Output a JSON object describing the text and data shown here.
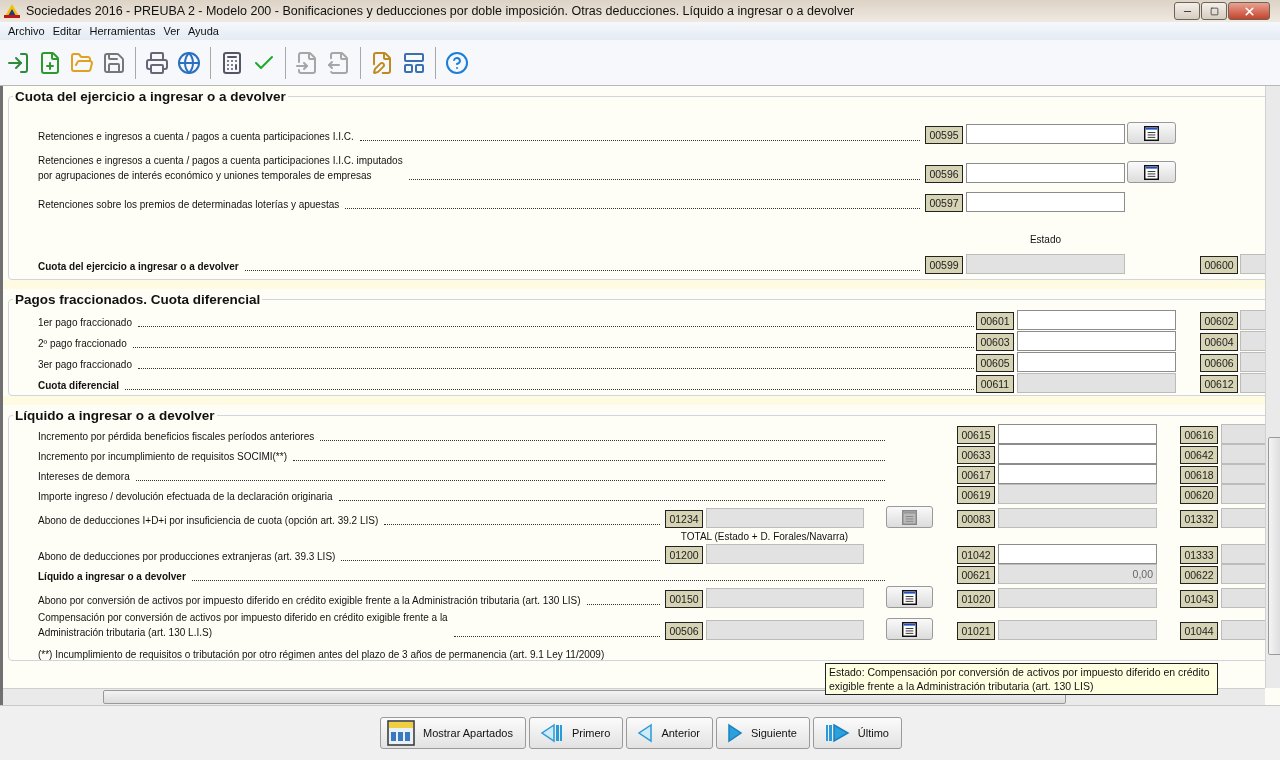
{
  "window": {
    "title": "Sociedades 2016 - PREUBA 2 - Modelo 200 - Bonificaciones y deducciones por doble imposición. Otras deducciones. Líquido a ingresar o a devolver"
  },
  "menu": [
    "Archivo",
    "Editar",
    "Herramientas",
    "Ver",
    "Ayuda"
  ],
  "toolbar": [
    {
      "kind": "button",
      "disabled": false
    },
    {
      "kind": "button",
      "disabled": false
    },
    {
      "kind": "button",
      "disabled": false
    },
    {
      "kind": "button",
      "disabled": false
    },
    {
      "kind": "separator"
    },
    {
      "kind": "button",
      "disabled": false
    },
    {
      "kind": "button",
      "disabled": false
    },
    {
      "kind": "separator"
    },
    {
      "kind": "button",
      "disabled": false
    },
    {
      "kind": "button",
      "disabled": false
    },
    {
      "kind": "separator"
    },
    {
      "kind": "button",
      "disabled": true
    },
    {
      "kind": "button",
      "disabled": true
    },
    {
      "kind": "separator"
    },
    {
      "kind": "button",
      "disabled": false
    },
    {
      "kind": "button",
      "disabled": false
    },
    {
      "kind": "separator"
    },
    {
      "kind": "button",
      "disabled": false
    }
  ],
  "sections": [
    {
      "title": "Cuota del ejercicio a ingresar o a devolver",
      "kind": "wide",
      "rows": [
        {
          "kind": "field",
          "label": "Retenciones e ingresos a cuenta / pagos a cuenta participaciones I.I.C.",
          "bold": false,
          "code": "00595",
          "disabled": false,
          "button": {
            "disabled": false
          }
        },
        {
          "kind": "field",
          "label": "Retenciones e ingresos a cuenta / pagos a cuenta participaciones I.I.C. imputados\npor agrupaciones de interés económico y uniones temporales de empresas",
          "bold": false,
          "code": "00596",
          "disabled": false,
          "button": {
            "disabled": false
          }
        },
        {
          "kind": "field",
          "label": "Retenciones sobre los premios de determinadas loterías y apuestas",
          "bold": false,
          "code": "00597",
          "disabled": false
        },
        {
          "kind": "caption",
          "text": "Estado"
        },
        {
          "kind": "field",
          "label": "Cuota del ejercicio a ingresar o a devolver",
          "bold": true,
          "code": "00599",
          "disabled": true,
          "right_code": "00600"
        }
      ]
    },
    {
      "title": "Pagos fraccionados. Cuota diferencial",
      "kind": "compact",
      "rows": [
        {
          "kind": "field",
          "label": "1er pago fraccionado",
          "bold": false,
          "code": "00601",
          "disabled": false,
          "right_code": "00602"
        },
        {
          "kind": "field",
          "label": "2º pago fraccionado",
          "bold": false,
          "code": "00603",
          "disabled": false,
          "right_code": "00604"
        },
        {
          "kind": "field",
          "label": "3er pago fraccionado",
          "bold": false,
          "code": "00605",
          "disabled": false,
          "right_code": "00606"
        },
        {
          "kind": "field",
          "label": "Cuota diferencial",
          "bold": true,
          "code": "00611",
          "disabled": true,
          "right_code": "00612"
        }
      ]
    },
    {
      "title": "Líquido a ingresar o a devolver",
      "kind": "split",
      "rows": [
        {
          "kind": "field",
          "label": "Incremento por pérdida beneficios fiscales períodos anteriores",
          "bold": false,
          "code": "00615",
          "disabled": false,
          "right_code": "00616"
        },
        {
          "kind": "field",
          "label": "Incremento por incumplimiento de requisitos SOCIMI(**)",
          "bold": false,
          "code": "00633",
          "disabled": false,
          "right_code": "00642"
        },
        {
          "kind": "field",
          "label": "Intereses de demora",
          "bold": false,
          "code": "00617",
          "disabled": false,
          "right_code": "00618"
        },
        {
          "kind": "field",
          "label": "Importe ingreso / devolución efectuada de la declaración originaria",
          "bold": false,
          "code": "00619",
          "disabled": true,
          "right_code": "00620"
        },
        {
          "kind": "field",
          "label": "Abono de deducciones I+D+i por insuficiencia de cuota (opción art. 39.2 LIS)",
          "bold": false,
          "code": "00083",
          "disabled": true,
          "right_code": "01332",
          "mid": {
            "code": "01234",
            "button": {
              "disabled": true
            }
          }
        },
        {
          "kind": "caption",
          "text": "TOTAL (Estado + D. Forales/Navarra)"
        },
        {
          "kind": "field",
          "label": "Abono de deducciones por producciones extranjeras (art. 39.3 LIS)",
          "bold": false,
          "code": "01042",
          "disabled": false,
          "right_code": "01333",
          "mid": {
            "code": "01200"
          }
        },
        {
          "kind": "field",
          "label": "Líquido a ingresar o a devolver",
          "bold": true,
          "code": "00621",
          "disabled": true,
          "value": "0,00",
          "right_code": "00622"
        },
        {
          "kind": "field",
          "label": "Abono por conversión de activos por impuesto diferido en crédito exigible frente a la Administración tributaria (art. 130 LIS)",
          "bold": false,
          "code": "01020",
          "disabled": true,
          "right_code": "01043",
          "mid": {
            "code": "00150",
            "button": {
              "disabled": false
            }
          }
        },
        {
          "kind": "field",
          "label": "Compensación por conversión de activos por impuesto diferido en crédito exigible frente a la\nAdministración tributaria (art. 130 L.I.S)",
          "bold": false,
          "code": "01021",
          "disabled": true,
          "right_code": "01044",
          "mid": {
            "code": "00506",
            "button": {
              "disabled": false
            }
          }
        },
        {
          "kind": "note",
          "text": "(**) Incumplimiento de requisitos o tributación por otro régimen antes del plazo de 3 años de permanencia (art. 9.1 Ley 11/2009)"
        }
      ]
    }
  ],
  "tooltip": {
    "text": "Estado: Compensación por conversión de activos por impuesto diferido en crédito\nexigible frente a la Administración tributaria (art. 130 LIS)"
  },
  "nav": [
    {
      "label": "Mostrar Apartados"
    },
    {
      "label": "Primero"
    },
    {
      "label": "Anterior"
    },
    {
      "label": "Siguiente"
    },
    {
      "label": "Último"
    }
  ]
}
